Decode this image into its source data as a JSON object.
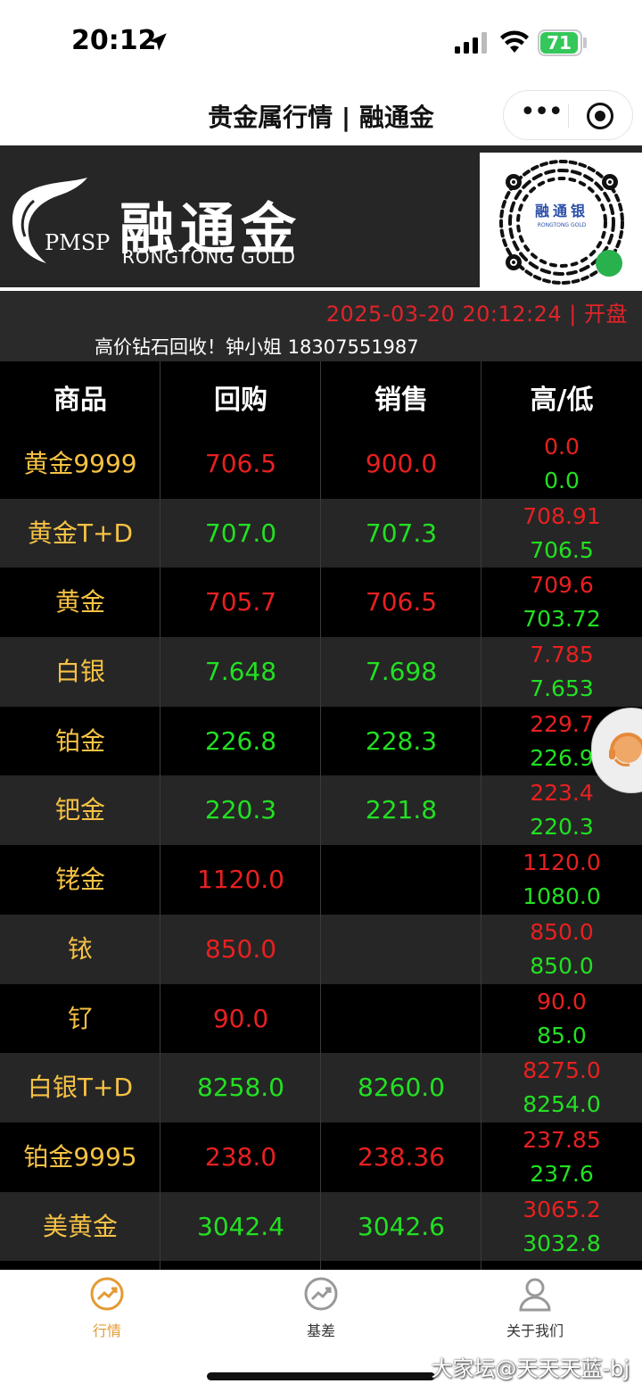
{
  "status_bar": {
    "time": "20:12",
    "battery": "71"
  },
  "nav": {
    "title": "贵金属行情 | 融通金"
  },
  "banner": {
    "logo_tag": "PMSP",
    "brand_cn": "融通金",
    "brand_en": "RONGTONG  GOLD",
    "qr_cn": "融通银",
    "qr_en": "RONGTONG GOLD"
  },
  "info": {
    "datetime": "2025-03-20 20:12:24 | 开盘",
    "notice": "高价钻石回收！钟小姐 18307551987"
  },
  "table": {
    "headers": [
      "商品",
      "回购",
      "销售",
      "高/低"
    ],
    "rows": [
      {
        "name": "黄金9999",
        "buy": "706.5",
        "sell": "900.0",
        "high": "0.0",
        "low": "0.0",
        "buy_color": "red",
        "sell_color": "red"
      },
      {
        "name": "黄金T+D",
        "buy": "707.0",
        "sell": "707.3",
        "high": "708.91",
        "low": "706.5",
        "buy_color": "green",
        "sell_color": "green"
      },
      {
        "name": "黄金",
        "buy": "705.7",
        "sell": "706.5",
        "high": "709.6",
        "low": "703.72",
        "buy_color": "red",
        "sell_color": "red"
      },
      {
        "name": "白银",
        "buy": "7.648",
        "sell": "7.698",
        "high": "7.785",
        "low": "7.653",
        "buy_color": "green",
        "sell_color": "green"
      },
      {
        "name": "铂金",
        "buy": "226.8",
        "sell": "228.3",
        "high": "229.7",
        "low": "226.9",
        "buy_color": "green",
        "sell_color": "green"
      },
      {
        "name": "钯金",
        "buy": "220.3",
        "sell": "221.8",
        "high": "223.4",
        "low": "220.3",
        "buy_color": "green",
        "sell_color": "green"
      },
      {
        "name": "铑金",
        "buy": "1120.0",
        "sell": "",
        "high": "1120.0",
        "low": "1080.0",
        "buy_color": "red",
        "sell_color": "red"
      },
      {
        "name": "铱",
        "buy": "850.0",
        "sell": "",
        "high": "850.0",
        "low": "850.0",
        "buy_color": "red",
        "sell_color": "red"
      },
      {
        "name": "钌",
        "buy": "90.0",
        "sell": "",
        "high": "90.0",
        "low": "85.0",
        "buy_color": "red",
        "sell_color": "red"
      },
      {
        "name": "白银T+D",
        "buy": "8258.0",
        "sell": "8260.0",
        "high": "8275.0",
        "low": "8254.0",
        "buy_color": "green",
        "sell_color": "green"
      },
      {
        "name": "铂金9995",
        "buy": "238.0",
        "sell": "238.36",
        "high": "237.85",
        "low": "237.6",
        "buy_color": "red",
        "sell_color": "red"
      },
      {
        "name": "美黄金",
        "buy": "3042.4",
        "sell": "3042.6",
        "high": "3065.2",
        "low": "3032.8",
        "buy_color": "green",
        "sell_color": "green"
      }
    ]
  },
  "tabs": [
    {
      "label": "行情",
      "icon": "trend-circle-icon",
      "active": true
    },
    {
      "label": "基差",
      "icon": "trend-circle-icon",
      "active": false
    },
    {
      "label": "关于我们",
      "icon": "user-icon",
      "active": false
    }
  ],
  "watermark": "大家坛@天天天蓝-bj",
  "colors": {
    "up": "#e82020",
    "down": "#22e022",
    "name": "#f7c244",
    "tab_active": "#e49a34"
  }
}
